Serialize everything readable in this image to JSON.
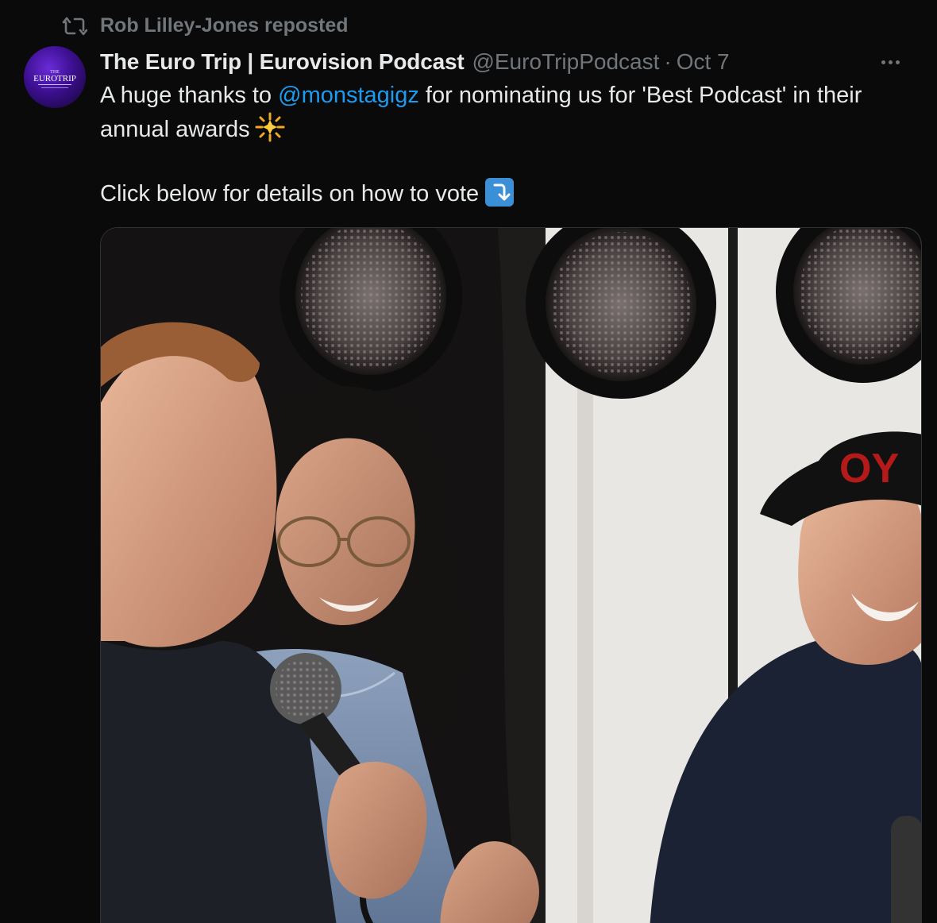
{
  "repost": {
    "icon": "repost-icon",
    "text": "Rob Lilley-Jones reposted"
  },
  "author": {
    "display_name": "The Euro Trip | Eurovision Podcast",
    "handle": "@EuroTripPodcast",
    "separator": "·",
    "date": "Oct 7",
    "avatar_text": "EUROTRIP"
  },
  "tweet": {
    "line1_pre": "A huge thanks to ",
    "mention": "@monstagigz",
    "line1_post": " for nominating us for 'Best Podcast' in their",
    "line2": "annual awards",
    "line2_emoji": "sun-sparkle-emoji",
    "line3": "Click below for details on how to vote",
    "line3_emoji": "arrow-down-right-emoji"
  },
  "media": {
    "description_icon": "photo-image",
    "hat_text": "OY"
  },
  "colors": {
    "background": "#0a0a0a",
    "text": "#e7e9ea",
    "muted": "#71767b",
    "link": "#1d9bf0"
  }
}
